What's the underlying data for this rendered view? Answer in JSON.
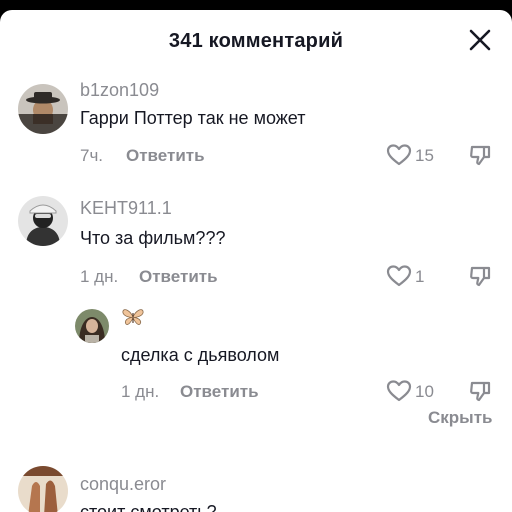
{
  "header": {
    "title": "341 комментарий"
  },
  "comments": [
    {
      "username": "b1zon109",
      "text": "Гарри Поттер так не может",
      "time": "7ч.",
      "reply_label": "Ответить",
      "likes": "15",
      "avatar_icon": "user-with-hat-avatar"
    },
    {
      "username": "KEHT911.1",
      "text": "Что за фильм???",
      "time": "1 дн.",
      "reply_label": "Ответить",
      "likes": "1",
      "avatar_icon": "masked-user-avatar"
    },
    {
      "username_icon": "butterfly-emoji",
      "text": "сделка с дьяволом",
      "time": "1 дн.",
      "reply_label": "Ответить",
      "likes": "10",
      "avatar_icon": "woman-avatar"
    },
    {
      "username": "conqu.eror",
      "text": "стоит смотреть?",
      "avatar_icon": "hands-avatar"
    }
  ],
  "hide_label": "Скрыть",
  "colors": {
    "primary_text": "#161823",
    "secondary_text": "#8a8b91",
    "background": "#ffffff"
  }
}
